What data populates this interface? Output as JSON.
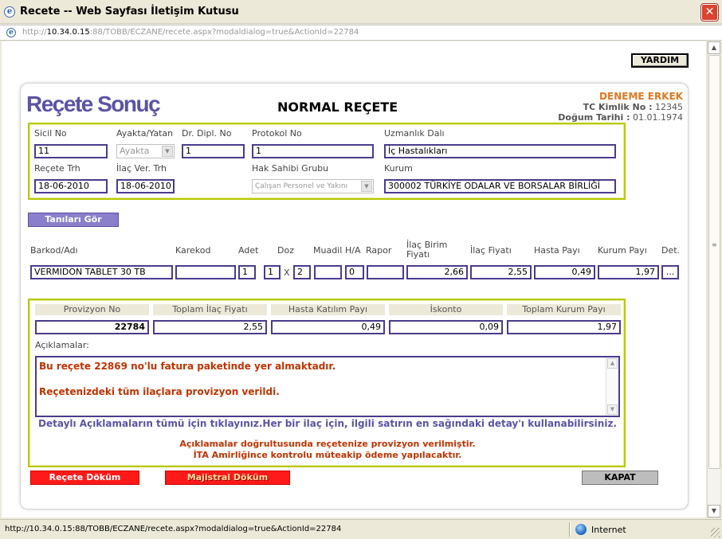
{
  "window": {
    "title": "Recete -- Web Sayfası İletişim Kutusu"
  },
  "address": {
    "prefix": "http://",
    "host": "10.34.0.15",
    "rest": ":88/TOBB/ECZANE/recete.aspx?modaldialog=true&ActionId=22784"
  },
  "toolbar": {
    "help_label": "YARDIM"
  },
  "header": {
    "title": "Reçete Sonuç",
    "rx_type": "NORMAL REÇETE",
    "patient_name": "DENEME ERKEK",
    "tc_label": "TC Kimlik No :",
    "tc_value": "12345",
    "dob_label": "Doğum Tarihi :",
    "dob_value": "01.01.1974"
  },
  "form": {
    "sicil_label": "Sicil No",
    "sicil_value": "11",
    "ayakta_label": "Ayakta/Yatan",
    "ayakta_value": "Ayakta",
    "diploma_label": "Dr. Dipl. No",
    "diploma_value": "1",
    "protokol_label": "Protokol No",
    "protokol_value": "1",
    "uzmanlik_label": "Uzmanlık Dalı",
    "uzmanlik_value": "İç Hastalıkları",
    "recete_trh_label": "Reçete Trh",
    "recete_trh_value": "18-06-2010",
    "ilac_ver_label": "İlaç Ver. Trh",
    "ilac_ver_value": "18-06-2010",
    "hak_label": "Hak Sahibi Grubu",
    "hak_value": "Çalışan Personel ve Yakını",
    "kurum_label": "Kurum",
    "kurum_value": "300002 TÜRKİYE ODALAR VE BORSALAR BİRLİĞİ"
  },
  "tanilar_button": "Tanıları Gör",
  "drug_table": {
    "headers": {
      "barkod": "Barkod/Adı",
      "karekod": "Karekod",
      "adet": "Adet",
      "doz": "Doz",
      "muadil": "Muadil",
      "ha": "H/A",
      "rapor": "Rapor",
      "birim": "İlaç Birim Fiyatı",
      "fiyat": "İlaç Fiyatı",
      "hasta": "Hasta Payı",
      "kurum": "Kurum Payı",
      "det": "Det."
    },
    "row": {
      "name": "VERMIDON TABLET 30 TB",
      "karekod": "",
      "adet": "1",
      "doz1": "1",
      "doz_x": "X",
      "doz2": "2",
      "muadil": "",
      "ha": "0",
      "rapor": "",
      "birim": "2,66",
      "fiyat": "2,55",
      "hasta": "0,49",
      "kurum": "1,97",
      "det": "..."
    }
  },
  "summary": {
    "provizyon_label": "Provizyon No",
    "provizyon_value": "22784",
    "toplam_label": "Toplam İlaç Fiyatı",
    "toplam_value": "2,55",
    "katilim_label": "Hasta Katılım Payı",
    "katilim_value": "0,49",
    "iskonto_label": "İskonto",
    "iskonto_value": "0,09",
    "kurum_label": "Toplam Kurum Payı",
    "kurum_value": "1,97",
    "aciklama_label": "Açıklamalar:",
    "note1": "Bu reçete 22869 no'lu fatura paketinde yer almaktadır.",
    "note2": "Reçetenizdeki tüm ilaçlara provizyon verildi.",
    "detail_link": "Detaylı Açıklamaların tümü için tıklayınız.Her bir ilaç için, ilgili satırın en sağındaki detay'ı kullanabilirsiniz.",
    "msg1": "Açıklamalar doğrultusunda reçetenize provizyon verilmiştir.",
    "msg2": "İTA Amirliğince kontrolu müteakip ödeme yapılacaktır."
  },
  "buttons": {
    "recete_dokum": "Reçete Döküm",
    "majistral_dokum": "Majistral Döküm",
    "kapat": "KAPAT"
  },
  "status": {
    "url": "http://10.34.0.15:88/TOBB/ECZANE/recete.aspx?modaldialog=true&ActionId=22784",
    "zone": "Internet"
  },
  "colors": {
    "accent": "#5b53a6",
    "frame": "#b8c800",
    "alert": "#c03300",
    "patient": "#e07820"
  }
}
